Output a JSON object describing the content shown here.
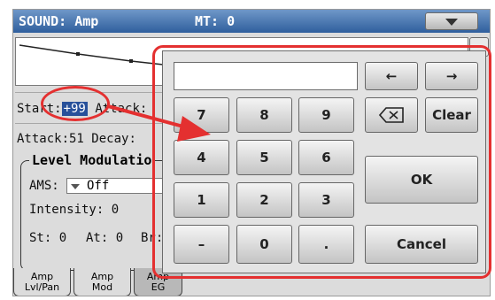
{
  "titlebar": {
    "title": "SOUND: Amp",
    "mode": "MT: 0"
  },
  "params": {
    "start_label": "Start:",
    "start_value": "+99",
    "attack_label": "Attack:",
    "attack_value_row2": "Attack:51",
    "decay_label": "Decay:",
    "group_title": "Level Modulatio",
    "ams_label": "AMS:",
    "ams_value": "Off",
    "intensity": "Intensity: 0",
    "st": "St: 0",
    "at": "At: 0",
    "br": "Br:"
  },
  "tabs": [
    {
      "line1": "Amp",
      "line2": "Lvl/Pan"
    },
    {
      "line1": "Amp",
      "line2": "Mod"
    },
    {
      "line1": "Amp",
      "line2": "EG"
    }
  ],
  "keypad": {
    "display_value": "",
    "left_arrow": "←",
    "right_arrow": "→",
    "clear": "Clear",
    "ok": "OK",
    "cancel": "Cancel",
    "digits": [
      "7",
      "8",
      "9",
      "4",
      "5",
      "6",
      "1",
      "2",
      "3",
      "–",
      "0",
      "."
    ]
  },
  "colors": {
    "annotation": "#e43030",
    "title_bar": "#2f5f9d",
    "highlight": "#27509a"
  }
}
